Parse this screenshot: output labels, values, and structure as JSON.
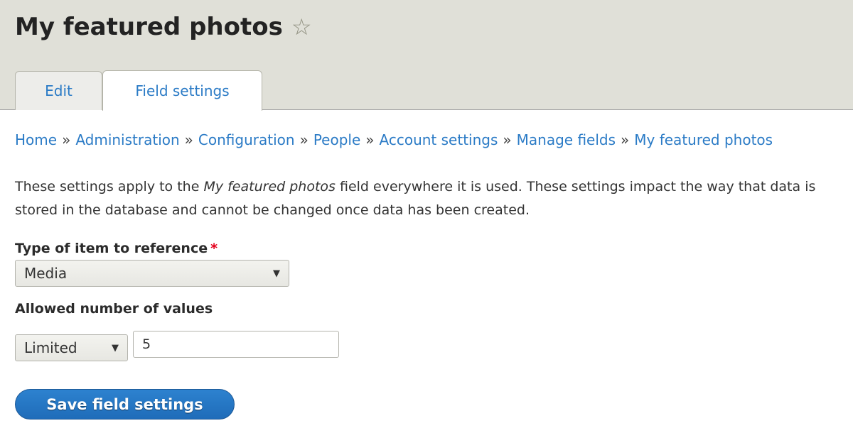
{
  "header": {
    "title": "My featured photos",
    "shortcut_icon": "star-outline-icon",
    "star_glyph": "☆"
  },
  "tabs": [
    {
      "label": "Edit",
      "active": false
    },
    {
      "label": "Field settings",
      "active": true
    }
  ],
  "breadcrumb": {
    "separator": "»",
    "items": [
      "Home",
      "Administration",
      "Configuration",
      "People",
      "Account settings",
      "Manage fields",
      "My featured photos"
    ]
  },
  "description": {
    "before": "These settings apply to the ",
    "emphasis": "My featured photos",
    "after": " field everywhere it is used. These settings impact the way that data is stored in the database and cannot be changed once data has been created."
  },
  "form": {
    "type_label": "Type of item to reference",
    "required_marker": "*",
    "type_value": "Media",
    "allowed_label": "Allowed number of values",
    "cardinality_value": "Limited",
    "number_value": "5",
    "dropdown_glyph": "▼",
    "save_label": "Save field settings"
  },
  "colors": {
    "link": "#2b7bc6",
    "header_bg": "#e0e0d8",
    "button": "#2273c2",
    "required": "#e4001c"
  }
}
